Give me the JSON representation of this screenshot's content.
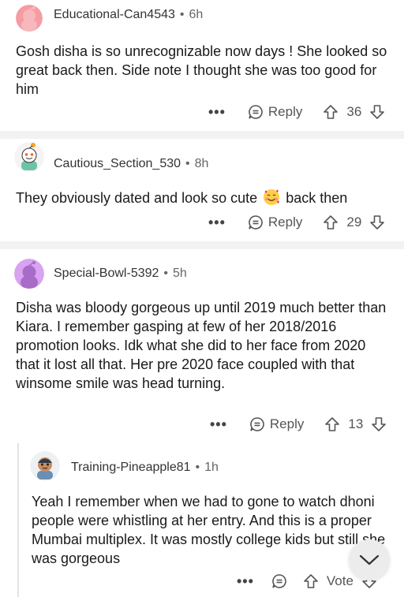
{
  "comments": [
    {
      "username": "Educational-Can4543",
      "time": "6h",
      "text": "Gosh disha is so unrecognizable now days ! She looked so great back then.  Side note I thought she was too good for him",
      "reply_label": "Reply",
      "score": "36",
      "avatar_color": "#f59ca3"
    },
    {
      "username": "Cautious_Section_530",
      "time": "8h",
      "text_before": "They obviously dated and look so cute",
      "emoji": "smiling-face-with-hearts",
      "text_after": "back then",
      "reply_label": "Reply",
      "score": "29"
    },
    {
      "username": "Special-Bowl-5392",
      "time": "5h",
      "text": "Disha was bloody gorgeous up until 2019 much better than Kiara. I remember gasping at few of her 2018/2016 promotion looks. Idk what she did to her face from 2020 that it lost all that. Her pre 2020 face coupled with that winsome smile was head turning.",
      "reply_label": "Reply",
      "score": "13",
      "avatar_color": "#d8a3f0"
    },
    {
      "username": "Training-Pineapple81",
      "time": "1h",
      "text": "Yeah I remember when we had to gone to watch dhoni people were whistling at her entry. And this is a proper Mumbai multiplex. It was mostly college kids but still she was gorgeous",
      "vote_label": "Vote"
    }
  ],
  "icons": {
    "more": "more-dots-icon",
    "reply": "reply-bubble-icon",
    "upvote": "upvote-arrow-icon",
    "downvote": "downvote-arrow-icon",
    "scroll": "chevron-down-icon"
  },
  "colors": {
    "separator": "#f2f2f2",
    "meta_text": "#333333",
    "body_text": "#1a1a1b"
  }
}
